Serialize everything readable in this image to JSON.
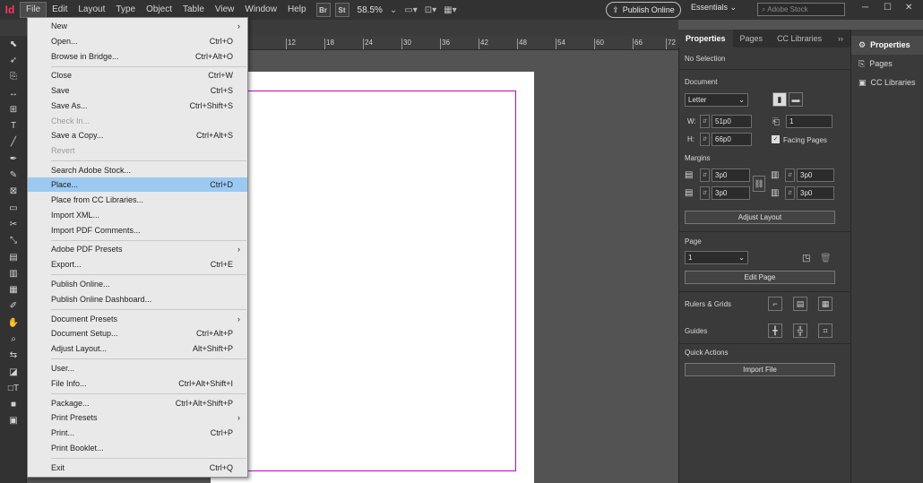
{
  "app": {
    "logo": "Id"
  },
  "menubar": {
    "items": [
      "File",
      "Edit",
      "Layout",
      "Type",
      "Object",
      "Table",
      "View",
      "Window",
      "Help"
    ],
    "bridge": "Br",
    "stock": "St",
    "zoom": "58.5%",
    "publish_online": "Publish Online",
    "workspace": "Essentials",
    "search_placeholder": "Adobe Stock"
  },
  "ruler": {
    "ticks": [
      "12",
      "18",
      "24",
      "30",
      "36",
      "42",
      "48",
      "54",
      "60",
      "66",
      "72"
    ]
  },
  "file_menu": {
    "items": [
      {
        "label": "New",
        "shortcut": "",
        "submenu": true
      },
      {
        "label": "Open...",
        "shortcut": "Ctrl+O"
      },
      {
        "label": "Browse in Bridge...",
        "shortcut": "Ctrl+Alt+O"
      },
      {
        "label": "Close",
        "shortcut": "Ctrl+W"
      },
      {
        "label": "Save",
        "shortcut": "Ctrl+S"
      },
      {
        "label": "Save As...",
        "shortcut": "Ctrl+Shift+S"
      },
      {
        "label": "Check In...",
        "shortcut": "",
        "disabled": true
      },
      {
        "label": "Save a Copy...",
        "shortcut": "Ctrl+Alt+S"
      },
      {
        "label": "Revert",
        "shortcut": "",
        "disabled": true
      },
      {
        "label": "Search Adobe Stock...",
        "shortcut": ""
      },
      {
        "label": "Place...",
        "shortcut": "Ctrl+D",
        "highlighted": true
      },
      {
        "label": "Place from CC Libraries...",
        "shortcut": ""
      },
      {
        "label": "Import XML...",
        "shortcut": ""
      },
      {
        "label": "Import PDF Comments...",
        "shortcut": ""
      },
      {
        "label": "Adobe PDF Presets",
        "shortcut": "",
        "submenu": true
      },
      {
        "label": "Export...",
        "shortcut": "Ctrl+E"
      },
      {
        "label": "Publish Online...",
        "shortcut": ""
      },
      {
        "label": "Publish Online Dashboard...",
        "shortcut": ""
      },
      {
        "label": "Document Presets",
        "shortcut": "",
        "submenu": true
      },
      {
        "label": "Document Setup...",
        "shortcut": "Ctrl+Alt+P"
      },
      {
        "label": "Adjust Layout...",
        "shortcut": "Alt+Shift+P"
      },
      {
        "label": "User...",
        "shortcut": ""
      },
      {
        "label": "File Info...",
        "shortcut": "Ctrl+Alt+Shift+I"
      },
      {
        "label": "Package...",
        "shortcut": "Ctrl+Alt+Shift+P"
      },
      {
        "label": "Print Presets",
        "shortcut": "",
        "submenu": true
      },
      {
        "label": "Print...",
        "shortcut": "Ctrl+P"
      },
      {
        "label": "Print Booklet...",
        "shortcut": ""
      },
      {
        "label": "Exit",
        "shortcut": "Ctrl+Q"
      }
    ]
  },
  "properties_panel": {
    "tabs": [
      "Properties",
      "Pages",
      "CC Libraries"
    ],
    "selection": "No Selection",
    "document_label": "Document",
    "page_size": "Letter",
    "w_label": "W:",
    "w_value": "51p0",
    "h_label": "H:",
    "h_value": "66p0",
    "pages_count": "1",
    "facing_pages": "Facing Pages",
    "margins_label": "Margins",
    "margin_top": "3p0",
    "margin_bottom": "3p0",
    "margin_left": "3p0",
    "margin_right": "3p0",
    "adjust_layout": "Adjust Layout",
    "page_label": "Page",
    "page_value": "1",
    "edit_page": "Edit Page",
    "rulers_grids": "Rulers & Grids",
    "guides": "Guides",
    "quick_actions": "Quick Actions",
    "import_file": "Import File"
  },
  "right_column": {
    "items": [
      "Properties",
      "Pages",
      "CC Libraries"
    ]
  }
}
